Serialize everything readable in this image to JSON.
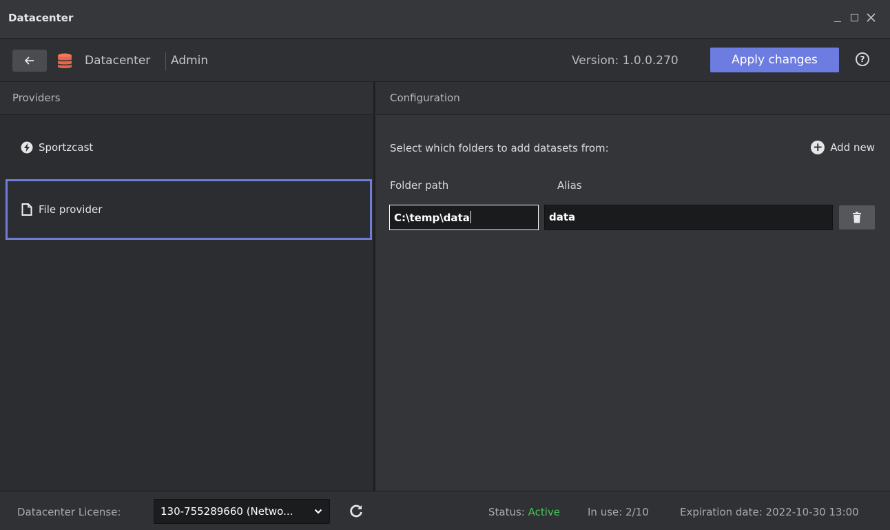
{
  "window": {
    "title": "Datacenter",
    "controls": [
      "minimize",
      "maximize",
      "close"
    ]
  },
  "toolbar": {
    "back_icon": "arrow-left-icon",
    "app_icon": "database-icon",
    "app_name": "Datacenter",
    "section": "Admin",
    "version": "Version: 1.0.0.270",
    "apply_label": "Apply changes",
    "help_icon": "question-circle-icon"
  },
  "providers": {
    "header": "Providers",
    "items": [
      {
        "label": "Sportzcast",
        "icon": "bolt-circle-icon",
        "selected": false
      },
      {
        "label": "File provider",
        "icon": "file-icon",
        "selected": true
      }
    ]
  },
  "configuration": {
    "header": "Configuration",
    "instruction": "Select which folders to add datasets from:",
    "add_new_label": "Add new",
    "columns": {
      "folder": "Folder path",
      "alias": "Alias"
    },
    "rows": [
      {
        "folder_path": "C:\\temp\\data",
        "alias": "data"
      }
    ]
  },
  "statusbar": {
    "license_label": "Datacenter License:",
    "license_value": "130-755289660 (Netwo...",
    "status_label": "Status: ",
    "status_value": "Active",
    "in_use": "In use: 2/10",
    "expiration": "Expiration date: 2022-10-30 13:00"
  },
  "colors": {
    "accent": "#6c7ce0",
    "selection_border": "#6f7ed4",
    "status_active": "#46c65a",
    "db_icon": "#e8664a"
  }
}
